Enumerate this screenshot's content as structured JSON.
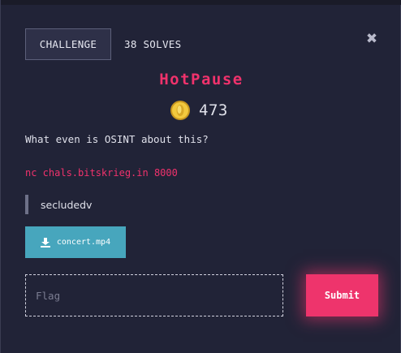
{
  "header": {
    "tab_challenge": "CHALLENGE",
    "solves": "38 SOLVES",
    "close_icon": "close-icon"
  },
  "challenge": {
    "title": "HotPause",
    "points": "473",
    "description": "What even is OSINT about this?",
    "connection": "nc chals.bitskrieg.in 8000",
    "author": "secludedv"
  },
  "attachment": {
    "filename": "concert.mp4",
    "icon": "download-icon"
  },
  "submission": {
    "placeholder": "Flag",
    "value": "",
    "submit_label": "Submit"
  },
  "colors": {
    "background": "#212337",
    "accent": "#ee346c",
    "file_button": "#47a6bd",
    "coin": "#e8c13b"
  }
}
